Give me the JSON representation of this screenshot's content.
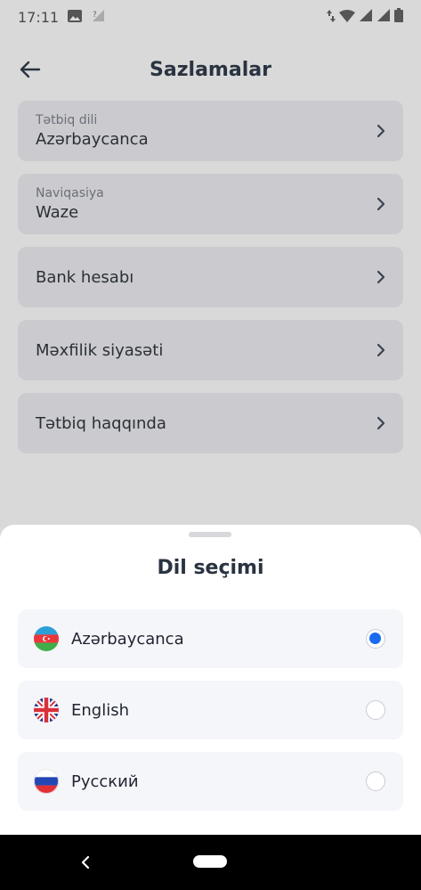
{
  "status_bar": {
    "time": "17:11"
  },
  "app_bar": {
    "title": "Sazlamalar"
  },
  "settings": {
    "app_language": {
      "label": "Tətbiq dili",
      "value": "Azərbaycanca"
    },
    "navigation": {
      "label": "Naviqasiya",
      "value": "Waze"
    },
    "bank_account": {
      "label": "Bank hesabı"
    },
    "privacy_policy": {
      "label": "Məxfilik siyasəti"
    },
    "about_app": {
      "label": "Tətbiq haqqında"
    }
  },
  "language_sheet": {
    "title": "Dil seçimi",
    "options": [
      {
        "label": "Azərbaycanca",
        "selected": true
      },
      {
        "label": "English",
        "selected": false
      },
      {
        "label": "Русский",
        "selected": false
      }
    ],
    "selected_color": "#1a6bf0"
  },
  "colors": {
    "background_dim": "#d9d9d9",
    "card": "#cbcbcf",
    "sheet": "#ffffff",
    "option_bg": "#f5f6fa"
  },
  "icons": [
    "image-icon",
    "no-signal-icon",
    "data-arrows-icon",
    "wifi-icon",
    "signal-icon",
    "battery-icon",
    "back-arrow-icon",
    "chevron-right-icon"
  ]
}
